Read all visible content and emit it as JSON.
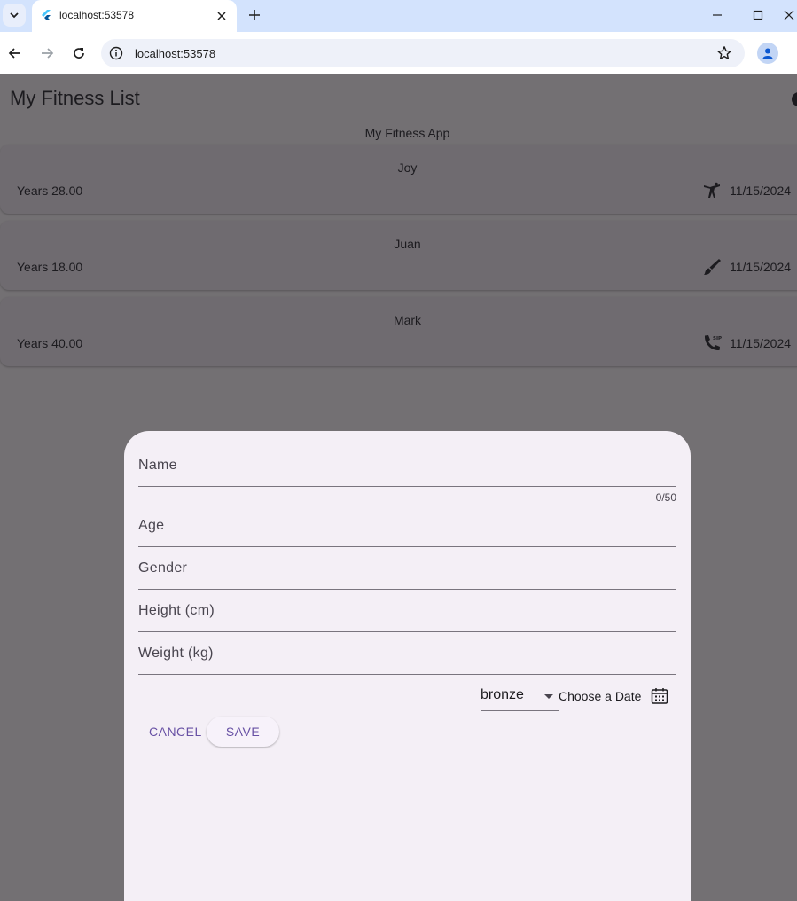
{
  "browser": {
    "tab_title": "localhost:53578",
    "url": "localhost:53578"
  },
  "app": {
    "title": "My Fitness List",
    "subtitle": "My Fitness App",
    "entries": [
      {
        "name": "Joy",
        "age": "Years 28.00",
        "icon": "sports-martial-arts-icon",
        "date": "11/15/2024"
      },
      {
        "name": "Juan",
        "age": "Years 18.00",
        "icon": "brush-icon",
        "date": "11/15/2024"
      },
      {
        "name": "Mark",
        "age": "Years 40.00",
        "icon": "sip-phone-icon",
        "date": "11/15/2024"
      }
    ]
  },
  "form": {
    "fields": {
      "name": "Name",
      "name_counter": "0/50",
      "age": "Age",
      "gender": "Gender",
      "height": "Height (cm)",
      "weight": "Weight (kg)"
    },
    "level_selected": "bronze",
    "choose_date": "Choose a Date",
    "cancel": "CANCEL",
    "save": "SAVE"
  },
  "colors": {
    "scrim": "#737073",
    "sheet": "#f4eff6",
    "accent": "#6750a4",
    "browser_tabbar": "#d3e3fd"
  }
}
